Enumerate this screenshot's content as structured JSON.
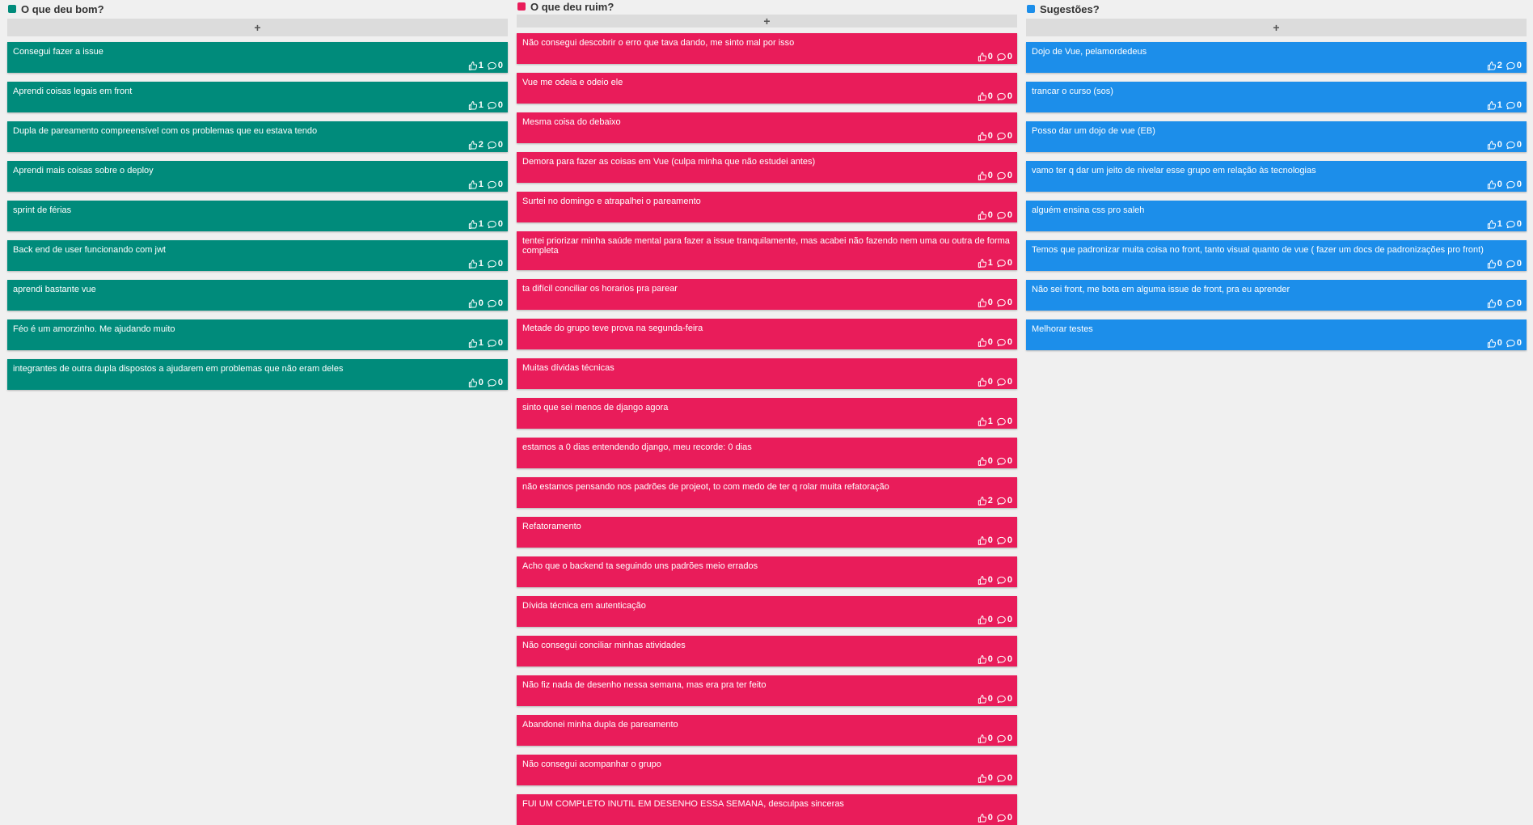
{
  "colors": {
    "good": "#008b7b",
    "bad": "#e91c5a",
    "suggest": "#1c8eea"
  },
  "columns": [
    {
      "title": "O que deu bom?",
      "variant": "green",
      "add_label": "+",
      "cards": [
        {
          "text": "Consegui fazer a issue",
          "likes": "1",
          "comments": "0"
        },
        {
          "text": "Aprendi coisas legais em front",
          "likes": "1",
          "comments": "0"
        },
        {
          "text": "Dupla de pareamento compreensível com os problemas que eu estava tendo",
          "likes": "2",
          "comments": "0"
        },
        {
          "text": "Aprendi mais coisas sobre o deploy",
          "likes": "1",
          "comments": "0"
        },
        {
          "text": "sprint de férias",
          "likes": "1",
          "comments": "0"
        },
        {
          "text": "Back end de user funcionando com jwt",
          "likes": "1",
          "comments": "0"
        },
        {
          "text": "aprendi bastante vue",
          "likes": "0",
          "comments": "0"
        },
        {
          "text": "Féo é um amorzinho. Me ajudando muito",
          "likes": "1",
          "comments": "0"
        },
        {
          "text": "integrantes de outra dupla dispostos a ajudarem em problemas que não eram deles",
          "likes": "0",
          "comments": "0"
        }
      ]
    },
    {
      "title": "O que deu ruim?",
      "variant": "red",
      "add_label": "+",
      "cards": [
        {
          "text": "Não consegui descobrir o erro que tava dando, me sinto mal por isso",
          "likes": "0",
          "comments": "0"
        },
        {
          "text": "Vue me odeia e odeio ele",
          "likes": "0",
          "comments": "0"
        },
        {
          "text": "Mesma coisa do debaixo",
          "likes": "0",
          "comments": "0"
        },
        {
          "text": "Demora para fazer as coisas em Vue (culpa minha que não estudei antes)",
          "likes": "0",
          "comments": "0"
        },
        {
          "text": "Surtei no domingo e atrapalhei o pareamento",
          "likes": "0",
          "comments": "0"
        },
        {
          "text": "tentei priorizar minha saúde mental para fazer a issue tranquilamente, mas acabei não fazendo nem uma ou outra de forma completa",
          "likes": "1",
          "comments": "0"
        },
        {
          "text": "ta difícil conciliar os horarios pra parear",
          "likes": "0",
          "comments": "0"
        },
        {
          "text": "Metade do grupo teve prova na segunda-feira",
          "likes": "0",
          "comments": "0"
        },
        {
          "text": "Muitas dívidas técnicas",
          "likes": "0",
          "comments": "0"
        },
        {
          "text": "sinto que sei menos de django agora",
          "likes": "1",
          "comments": "0"
        },
        {
          "text": "estamos a 0 dias entendendo django, meu recorde: 0 dias",
          "likes": "0",
          "comments": "0"
        },
        {
          "text": "não estamos pensando nos padrões de projeot, to com medo de ter q rolar muita refatoração",
          "likes": "2",
          "comments": "0"
        },
        {
          "text": "Refatoramento",
          "likes": "0",
          "comments": "0"
        },
        {
          "text": "Acho que o backend ta seguindo uns padrões meio errados",
          "likes": "0",
          "comments": "0"
        },
        {
          "text": "Dívida técnica em autenticação",
          "likes": "0",
          "comments": "0"
        },
        {
          "text": "Não consegui conciliar minhas atividades",
          "likes": "0",
          "comments": "0"
        },
        {
          "text": "Não fiz nada de desenho nessa semana, mas era pra ter feito",
          "likes": "0",
          "comments": "0"
        },
        {
          "text": "Abandonei minha dupla de pareamento",
          "likes": "0",
          "comments": "0"
        },
        {
          "text": "Não consegui acompanhar o grupo",
          "likes": "0",
          "comments": "0"
        },
        {
          "text": "FUI UM COMPLETO INUTIL EM DESENHO ESSA SEMANA, desculpas sinceras",
          "likes": "0",
          "comments": "0"
        }
      ]
    },
    {
      "title": "Sugestões?",
      "variant": "blue",
      "add_label": "+",
      "cards": [
        {
          "text": "Dojo de Vue, pelamordedeus",
          "likes": "2",
          "comments": "0"
        },
        {
          "text": "trancar o curso (sos)",
          "likes": "1",
          "comments": "0"
        },
        {
          "text": "Posso dar um dojo de vue (EB)",
          "likes": "0",
          "comments": "0"
        },
        {
          "text": "vamo ter q dar um jeito de nivelar esse grupo em relação às tecnologias",
          "likes": "0",
          "comments": "0"
        },
        {
          "text": "alguém ensina css pro saleh",
          "likes": "1",
          "comments": "0"
        },
        {
          "text": "Temos que padronizar muita coisa no front, tanto visual quanto de vue ( fazer um docs de padronizações pro front)",
          "likes": "0",
          "comments": "0"
        },
        {
          "text": "Não sei front, me bota em alguma issue de front, pra eu aprender",
          "likes": "0",
          "comments": "0"
        },
        {
          "text": "Melhorar testes",
          "likes": "0",
          "comments": "0"
        }
      ]
    }
  ]
}
